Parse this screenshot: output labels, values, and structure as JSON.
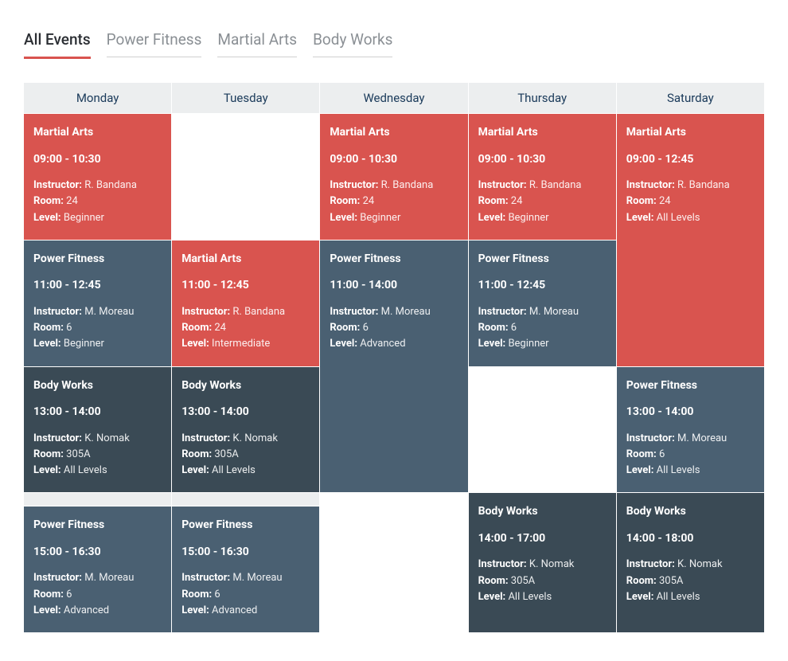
{
  "tabs": [
    {
      "label": "All Events",
      "active": true
    },
    {
      "label": "Power Fitness",
      "active": false
    },
    {
      "label": "Martial Arts",
      "active": false
    },
    {
      "label": "Body Works",
      "active": false
    }
  ],
  "labels": {
    "instructor": "Instructor:",
    "room": "Room:",
    "level": "Level:"
  },
  "days": [
    "Monday",
    "Tuesday",
    "Wednesday",
    "Thursday",
    "Saturday"
  ],
  "grid": [
    [
      {
        "title": "Martial Arts",
        "time": "09:00 - 10:30",
        "instructor": "R. Bandana",
        "room": "24",
        "level": "Beginner",
        "color": "red"
      },
      {
        "empty": true
      },
      {
        "title": "Martial Arts",
        "time": "09:00 - 10:30",
        "instructor": "R. Bandana",
        "room": "24",
        "level": "Beginner",
        "color": "red"
      },
      {
        "title": "Martial Arts",
        "time": "09:00 - 10:30",
        "instructor": "R. Bandana",
        "room": "24",
        "level": "Beginner",
        "color": "red"
      },
      {
        "title": "Martial Arts",
        "time": "09:00 - 12:45",
        "instructor": "R. Bandana",
        "room": "24",
        "level": "All Levels",
        "color": "red",
        "rowspan": 2
      }
    ],
    [
      {
        "title": "Power Fitness",
        "time": "11:00 - 12:45",
        "instructor": "M. Moreau",
        "room": "6",
        "level": "Beginner",
        "color": "slate"
      },
      {
        "title": "Martial Arts",
        "time": "11:00 - 12:45",
        "instructor": "R. Bandana",
        "room": "24",
        "level": "Intermediate",
        "color": "red"
      },
      {
        "title": "Power Fitness",
        "time": "11:00 - 14:00",
        "instructor": "M. Moreau",
        "room": "6",
        "level": "Advanced",
        "color": "slate",
        "rowspan": 2
      },
      {
        "title": "Power Fitness",
        "time": "11:00 - 12:45",
        "instructor": "M. Moreau",
        "room": "6",
        "level": "Beginner",
        "color": "slate"
      },
      {
        "skip": true
      }
    ],
    [
      {
        "title": "Body Works",
        "time": "13:00 - 14:00",
        "instructor": "K. Nomak",
        "room": "305A",
        "level": "All Levels",
        "color": "dark"
      },
      {
        "title": "Body Works",
        "time": "13:00 - 14:00",
        "instructor": "K. Nomak",
        "room": "305A",
        "level": "All Levels",
        "color": "dark"
      },
      {
        "skip": true
      },
      {
        "empty": true
      },
      {
        "title": "Power Fitness",
        "time": "13:00 - 14:00",
        "instructor": "M. Moreau",
        "room": "6",
        "level": "All Levels",
        "color": "slate"
      }
    ],
    [
      {
        "emptyShort": true
      },
      {
        "emptyShort": true
      },
      {
        "empty": true
      },
      {
        "title": "Body Works",
        "time": "14:00 - 17:00",
        "instructor": "K. Nomak",
        "room": "305A",
        "level": "All Levels",
        "color": "dark",
        "rowspan": 2
      },
      {
        "title": "Body Works",
        "time": "14:00 - 18:00",
        "instructor": "K. Nomak",
        "room": "305A",
        "level": "All Levels",
        "color": "dark",
        "rowspan": 2
      }
    ],
    [
      {
        "title": "Power Fitness",
        "time": "15:00 - 16:30",
        "instructor": "M. Moreau",
        "room": "6",
        "level": "Advanced",
        "color": "slate"
      },
      {
        "title": "Power Fitness",
        "time": "15:00 - 16:30",
        "instructor": "M. Moreau",
        "room": "6",
        "level": "Advanced",
        "color": "slate"
      },
      {
        "empty": true
      },
      {
        "skip": true
      },
      {
        "skip": true
      }
    ]
  ]
}
